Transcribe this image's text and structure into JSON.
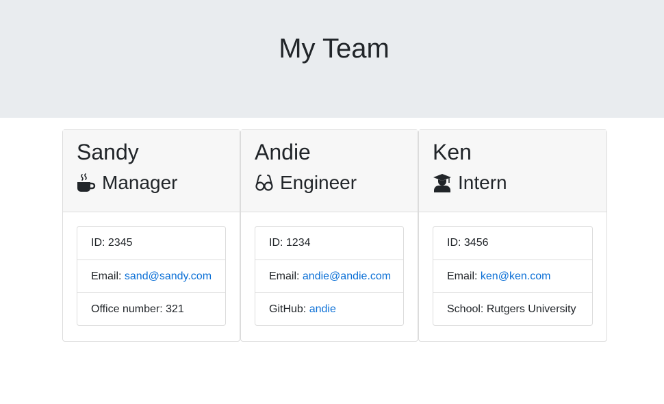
{
  "page": {
    "title": "My Team"
  },
  "team": [
    {
      "name": "Sandy",
      "role": "Manager",
      "role_icon": "coffee-mug-icon",
      "id_label": "ID: ",
      "id": "2345",
      "email_label": "Email: ",
      "email": "sand@sandy.com",
      "extra_label": "Office number: ",
      "extra_value": "321"
    },
    {
      "name": "Andie",
      "role": "Engineer",
      "role_icon": "glasses-icon",
      "id_label": "ID: ",
      "id": "1234",
      "email_label": "Email: ",
      "email": "andie@andie.com",
      "extra_label": "GitHub: ",
      "extra_value": "andie"
    },
    {
      "name": "Ken",
      "role": "Intern",
      "role_icon": "graduate-icon",
      "id_label": "ID: ",
      "id": "3456",
      "email_label": "Email: ",
      "email": "ken@ken.com",
      "extra_label": "School: ",
      "extra_value": "Rutgers University"
    }
  ],
  "colors": {
    "link": "#0a6fd6",
    "header_bg": "#e9ecef",
    "card_header_bg": "#f7f7f7"
  }
}
